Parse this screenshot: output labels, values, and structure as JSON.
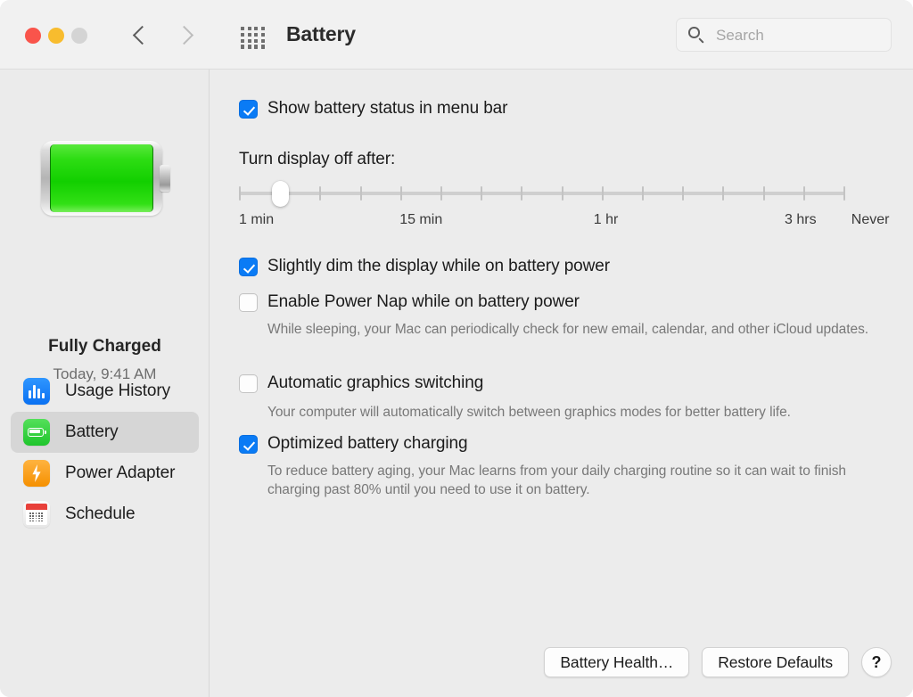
{
  "window": {
    "title": "Battery",
    "traffic_lights": [
      "close",
      "minimize",
      "zoom"
    ],
    "nav_back_icon": "chevron-left-icon",
    "nav_forward_icon": "chevron-right-icon",
    "grid_icon": "grid-apps-icon"
  },
  "search": {
    "placeholder": "Search",
    "value": "",
    "icon": "search-icon"
  },
  "sidebar": {
    "battery_icon": "battery-full-icon",
    "status": "Fully Charged",
    "timestamp": "Today, 9:41 AM",
    "items": [
      {
        "label": "Usage History",
        "icon": "usage-history-icon",
        "selected": false
      },
      {
        "label": "Battery",
        "icon": "battery-icon",
        "selected": true
      },
      {
        "label": "Power Adapter",
        "icon": "power-adapter-icon",
        "selected": false
      },
      {
        "label": "Schedule",
        "icon": "schedule-calendar-icon",
        "selected": false
      }
    ]
  },
  "main": {
    "show_battery_status": {
      "label": "Show battery status in menu bar",
      "checked": true
    },
    "display_off": {
      "label": "Turn display off after:",
      "slider": {
        "tick_count": 16,
        "value_index": 1,
        "labels": [
          {
            "text": "1 min",
            "pos_pct": 0
          },
          {
            "text": "15 min",
            "pos_pct": 26.5
          },
          {
            "text": "1 hr",
            "pos_pct": 58.5
          },
          {
            "text": "3 hrs",
            "pos_pct": 90
          },
          {
            "text": "Never",
            "pos_pct": 101
          }
        ]
      }
    },
    "options": [
      {
        "label": "Slightly dim the display while on battery power",
        "checked": true,
        "description": ""
      },
      {
        "label": "Enable Power Nap while on battery power",
        "checked": false,
        "description": "While sleeping, your Mac can periodically check for new email, calendar, and other iCloud updates."
      },
      {
        "label": "Automatic graphics switching",
        "checked": false,
        "description": "Your computer will automatically switch between graphics modes for better battery life."
      },
      {
        "label": "Optimized battery charging",
        "checked": true,
        "description": "To reduce battery aging, your Mac learns from your daily charging routine so it can wait to finish charging past 80% until you need to use it on battery."
      }
    ]
  },
  "footer": {
    "battery_health": "Battery Health…",
    "restore_defaults": "Restore Defaults",
    "help": "?"
  },
  "colors": {
    "accent": "#0A7BF5",
    "battery_green": "#12CF00",
    "toolbar_bg": "#F1F1F1",
    "sidebar_bg": "#EBEBEB",
    "content_bg": "#ECECEC"
  }
}
